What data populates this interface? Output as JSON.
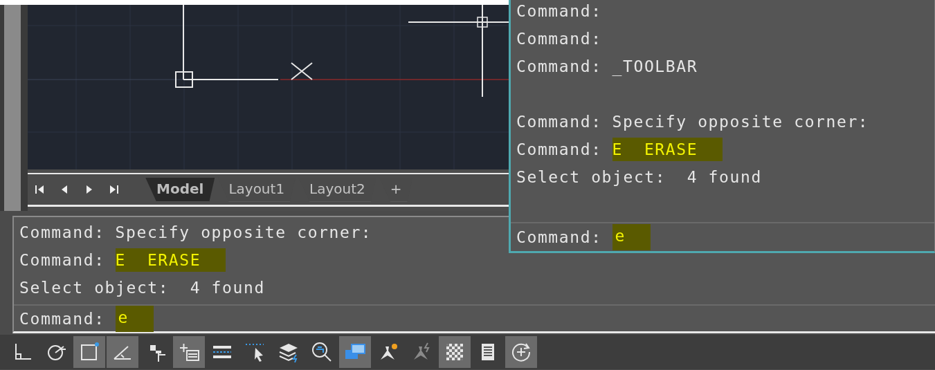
{
  "layout_tabs": [
    {
      "label": "Model",
      "selected": true
    },
    {
      "label": "Layout1",
      "selected": false
    },
    {
      "label": "Layout2",
      "selected": false
    },
    {
      "label": "+",
      "selected": false
    }
  ],
  "command_line": {
    "history": [
      {
        "prompt": "Command:",
        "text": "Specify opposite corner:",
        "highlighted": false
      },
      {
        "prompt": "Command:",
        "text": "E  ERASE",
        "highlighted": true
      },
      {
        "prompt": "Select object:",
        "text": " 4 found",
        "highlighted": false
      }
    ],
    "input": {
      "prompt": "Command:",
      "value": "e",
      "highlighted": true
    }
  },
  "history_window": {
    "lines": [
      {
        "kind": "text",
        "prompt": "Command:",
        "highlighted": false
      },
      {
        "kind": "text",
        "prompt": "Command:",
        "highlighted": false
      },
      {
        "kind": "text",
        "prompt": "Command:",
        "text": "_TOOLBAR",
        "highlighted": false
      },
      {
        "kind": "gap"
      },
      {
        "kind": "text",
        "prompt": "Command:",
        "text": "Specify opposite corner:",
        "highlighted": false
      },
      {
        "kind": "text",
        "prompt": "Command:",
        "text": "E  ERASE",
        "highlighted": true
      },
      {
        "kind": "text",
        "prompt": "Select object:",
        "text": " 4 found",
        "highlighted": false
      },
      {
        "kind": "gap"
      }
    ],
    "input": {
      "prompt": "Command:",
      "value": "e",
      "highlighted": true
    }
  },
  "status_bar": [
    {
      "kind": "ortho",
      "on": false
    },
    {
      "kind": "polar",
      "on": false
    },
    {
      "kind": "snapbox",
      "on": true
    },
    {
      "kind": "angle",
      "on": true
    },
    {
      "kind": "steps",
      "on": false
    },
    {
      "kind": "pluslist",
      "on": true
    },
    {
      "kind": "lines",
      "on": false
    },
    {
      "kind": "cursor",
      "on": false
    },
    {
      "kind": "layers",
      "on": false
    },
    {
      "kind": "zoom",
      "on": false
    },
    {
      "kind": "windows",
      "on": true
    },
    {
      "kind": "bulb",
      "on": false
    },
    {
      "kind": "bolt",
      "on": false
    },
    {
      "kind": "checker",
      "on": true
    },
    {
      "kind": "sheet",
      "on": false
    },
    {
      "kind": "circleplus",
      "on": true
    }
  ]
}
